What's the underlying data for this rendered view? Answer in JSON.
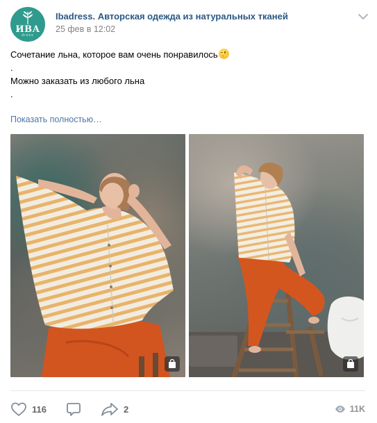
{
  "post": {
    "author": "Ibadress. Авторская одежда из натуральных тканей",
    "date": "25 фев в 12:02",
    "avatar": {
      "title": "ИВА",
      "subtitle": "dress",
      "color": "#2f9b8e"
    },
    "text_lines": [
      "Сочетание льна, которое вам очень понравилось",
      ".",
      "Можно заказать из любого льна",
      "."
    ],
    "emoji": "wink-emoji",
    "show_more": "Показать полностью…",
    "photos": [
      {
        "name": "photo-woman-striped-top-orange-pants-1",
        "badge": "shopping-bag-icon"
      },
      {
        "name": "photo-woman-on-ladder-2",
        "badge": "shopping-bag-icon"
      }
    ]
  },
  "actions": {
    "likes": "116",
    "comments": "",
    "shares": "2",
    "views": "11K"
  },
  "colors": {
    "link": "#2a5885",
    "show_more": "#4a76a8",
    "muted": "#828282",
    "icon": "#818c99"
  }
}
